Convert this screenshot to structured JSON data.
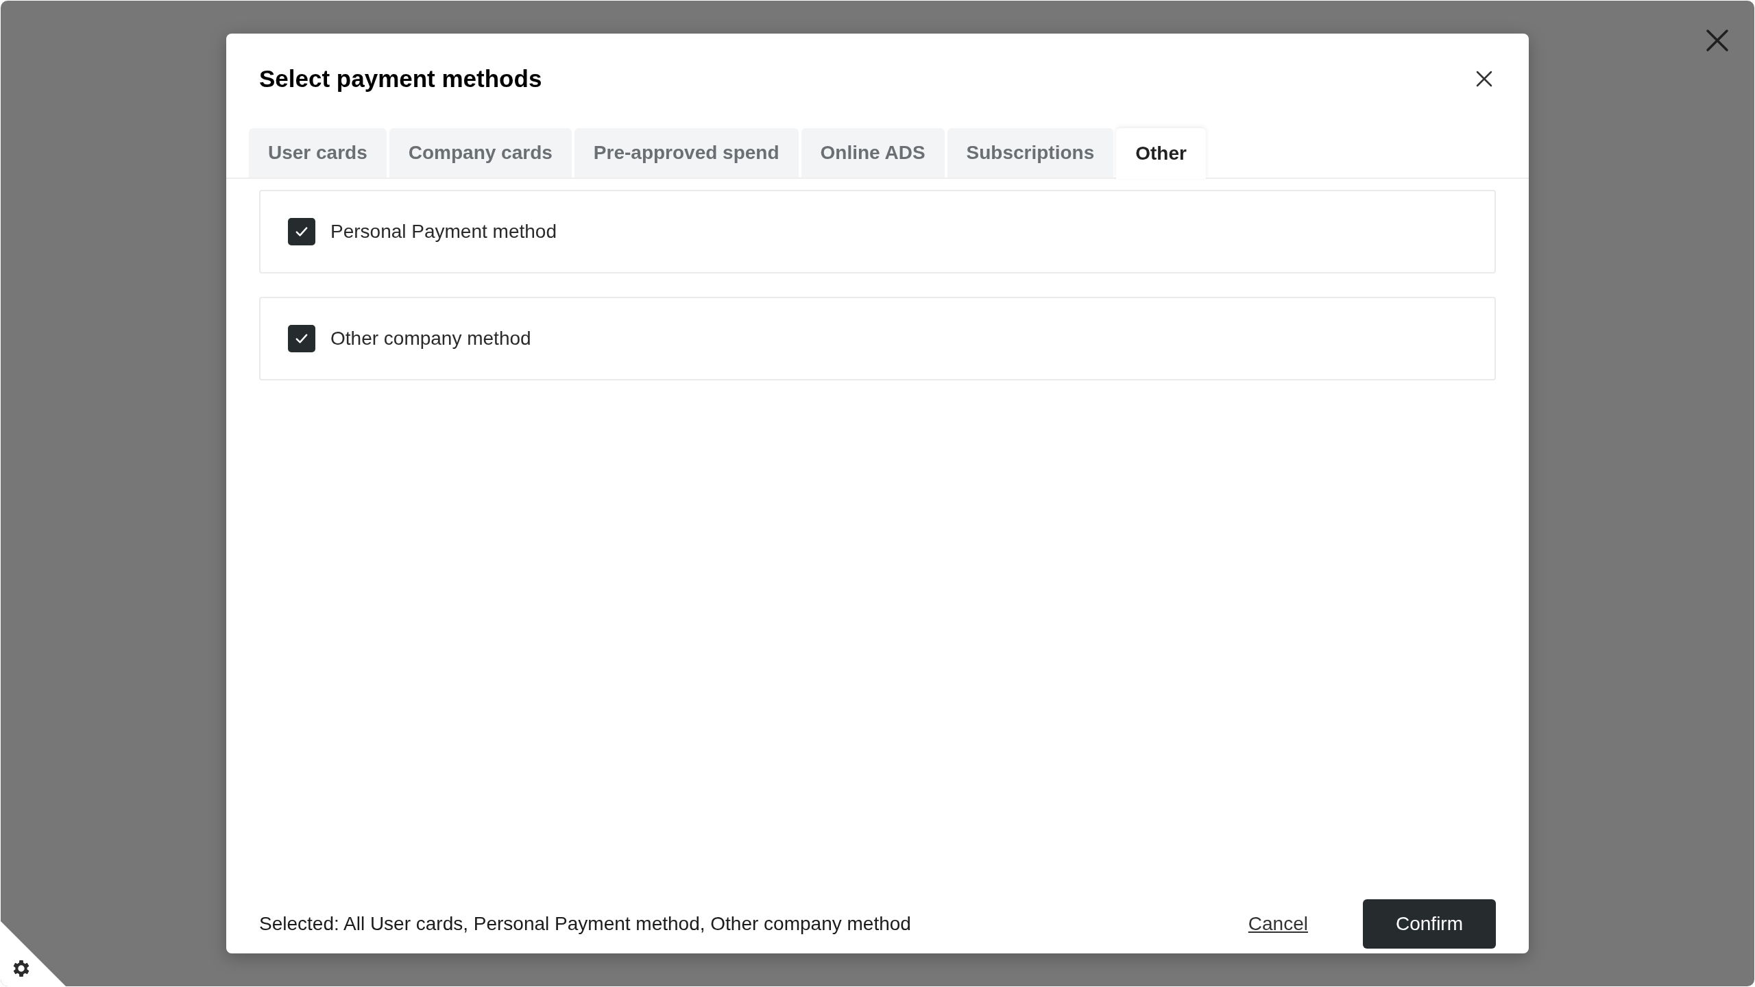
{
  "dialog": {
    "title": "Select payment methods",
    "tabs": [
      {
        "label": "User cards",
        "selected": false
      },
      {
        "label": "Company cards",
        "selected": false
      },
      {
        "label": "Pre-approved spend",
        "selected": false
      },
      {
        "label": "Online ADS",
        "selected": false
      },
      {
        "label": "Subscriptions",
        "selected": false
      },
      {
        "label": "Other",
        "selected": true
      }
    ],
    "options": [
      {
        "label": "Personal Payment method",
        "checked": true
      },
      {
        "label": "Other company method",
        "checked": true
      }
    ],
    "summary": "Selected: All User cards, Personal Payment method, Other company method",
    "buttons": {
      "cancel": "Cancel",
      "confirm": "Confirm"
    }
  }
}
